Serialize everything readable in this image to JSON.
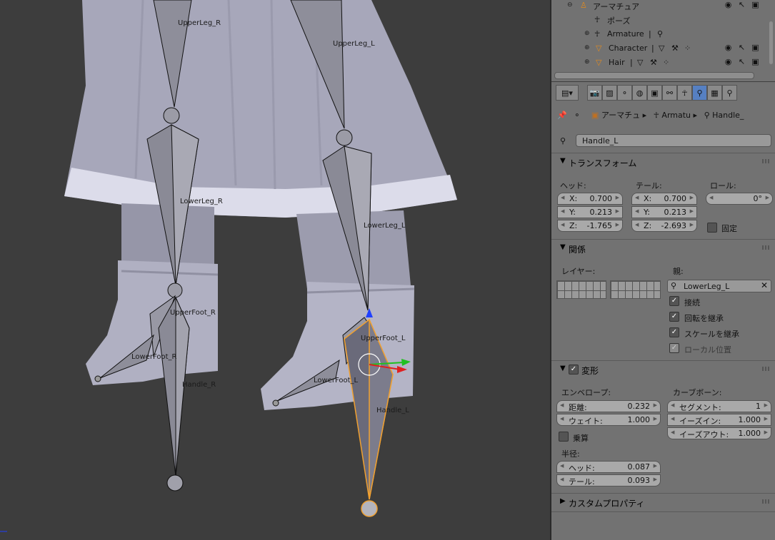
{
  "viewport": {
    "bone_labels": [
      "UpperLeg_R",
      "UpperLeg_L",
      "LowerLeg_R",
      "LowerLeg_L",
      "UpperFoot_R",
      "UpperFoot_L",
      "LowerFoot_R",
      "LowerFoot_L",
      "Handle_R",
      "Handle_L"
    ]
  },
  "outliner": {
    "rows": [
      {
        "label": "アーマチュア",
        "icon": "armature-icon"
      },
      {
        "label": "ポーズ",
        "icon": "pose-icon"
      },
      {
        "label": "Armature",
        "icon": "armature-data-icon"
      },
      {
        "label": "Character",
        "icon": "mesh-object-icon"
      },
      {
        "label": "Hair",
        "icon": "mesh-object-icon"
      }
    ]
  },
  "properties": {
    "breadcrumb": [
      "アーマチュ",
      "Armatu",
      "Handle_"
    ],
    "bone_name": "Handle_L",
    "transform": {
      "title": "トランスフォーム",
      "head_label": "ヘッド:",
      "tail_label": "テール:",
      "roll_label": "ロール:",
      "head": {
        "x": "0.700",
        "y": "0.213",
        "z": "-1.765"
      },
      "tail": {
        "x": "0.700",
        "y": "0.213",
        "z": "-2.693"
      },
      "roll": "0°",
      "lock_label": "固定",
      "x_label": "X:",
      "y_label": "Y:",
      "z_label": "Z:"
    },
    "relations": {
      "title": "関係",
      "layer_label": "レイヤー:",
      "parent_label": "親:",
      "parent": "LowerLeg_L",
      "connected": "接続",
      "inherit_rotation": "回転を継承",
      "inherit_scale": "スケールを継承",
      "local_location": "ローカル位置"
    },
    "deform": {
      "title": "変形",
      "envelope_label": "エンベロープ:",
      "distance_label": "距離:",
      "distance": "0.232",
      "weight_label": "ウェイト:",
      "weight": "1.000",
      "multiply_label": "乗算",
      "radius_label": "半径:",
      "head_label": "ヘッド:",
      "head": "0.087",
      "tail_label": "テール:",
      "tail": "0.093",
      "curve_label": "カーブボーン:",
      "segments_label": "セグメント:",
      "segments": "1",
      "ease_in_label": "イーズイン:",
      "ease_in": "1.000",
      "ease_out_label": "イーズアウト:",
      "ease_out": "1.000"
    },
    "custom_props": {
      "title": "カスタムプロパティ"
    }
  },
  "colors": {
    "selected_bone": "#f0a030",
    "active_tab": "#5680c2"
  }
}
